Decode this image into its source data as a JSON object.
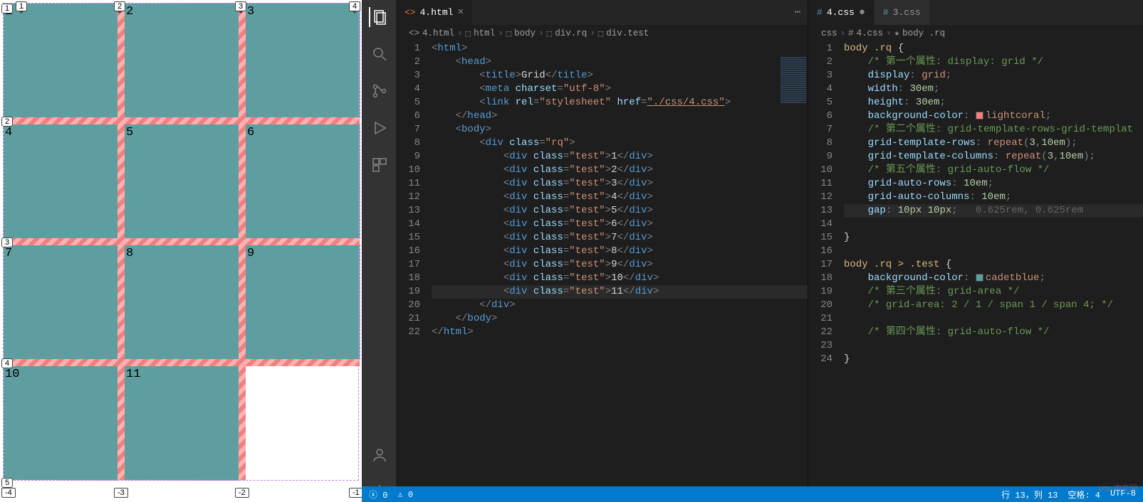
{
  "preview": {
    "cells": [
      "1",
      "2",
      "3",
      "4",
      "5",
      "6",
      "7",
      "8",
      "9",
      "10",
      "11"
    ],
    "col_labels": [
      "1",
      "2",
      "3",
      "4"
    ],
    "row_labels": [
      "1",
      "2",
      "3",
      "4",
      "5"
    ],
    "neg_labels": [
      "-4",
      "-3",
      "-2",
      "-1"
    ]
  },
  "activity": {
    "icons": [
      "files",
      "search",
      "source-control",
      "debug",
      "extensions"
    ],
    "bottom": [
      "account",
      "gear"
    ]
  },
  "left_editor": {
    "tabs": [
      {
        "icon": "html",
        "name": "4.html",
        "active": true,
        "dirty": false
      }
    ],
    "more": "⋯",
    "breadcrumb": [
      "4.html",
      "html",
      "body",
      "div.rq",
      "div.test"
    ],
    "breadcrumb_icons": [
      "html-file",
      "cube",
      "cube",
      "cube",
      "cube"
    ],
    "lines": {
      "count": 22,
      "title_text": "Grid",
      "charset": "utf-8",
      "rel": "stylesheet",
      "href": "./css/4.css",
      "rq_class": "rq",
      "test_class": "test",
      "items": [
        "1",
        "2",
        "3",
        "4",
        "5",
        "6",
        "7",
        "8",
        "9",
        "10",
        "11"
      ]
    }
  },
  "right_editor": {
    "tabs": [
      {
        "icon": "css",
        "name": "4.css",
        "active": true,
        "dirty": true
      },
      {
        "icon": "css",
        "name": "3.css",
        "active": false,
        "dirty": false
      }
    ],
    "breadcrumb": [
      "css",
      "4.css",
      "body .rq"
    ],
    "css": {
      "sel1": "body .rq",
      "c1": "/* 第一个属性: display: grid */",
      "display": "grid",
      "width": "30em",
      "height": "30em",
      "bg1": "lightcoral",
      "bg1_swatch": "#f08080",
      "c2": "/* 第二个属性: grid-template-rows-grid-templat",
      "gtr": "repeat(3,10em)",
      "gtc": "repeat(3,10em)",
      "c5": "/* 第五个属性: grid-auto-flow */",
      "gar": "10em",
      "gac": "10em",
      "gap": "10px 10px",
      "gap_hint": "0.625rem, 0.625rem",
      "sel2": "body .rq > .test",
      "bg2": "cadetblue",
      "bg2_swatch": "#5f9ea0",
      "c3": "/* 第三个属性: grid-area */",
      "c3b": "/* grid-area: 2 / 1 / span 1 / span 4; */",
      "c4": "/* 第四个属性: grid-auto-flow */"
    }
  },
  "status": {
    "errors": "0",
    "warnings": "0",
    "ln": "行 13，列 13",
    "spaces": "空格: 4",
    "enc": "UTF-8"
  },
  "watermark": "php 中文网"
}
